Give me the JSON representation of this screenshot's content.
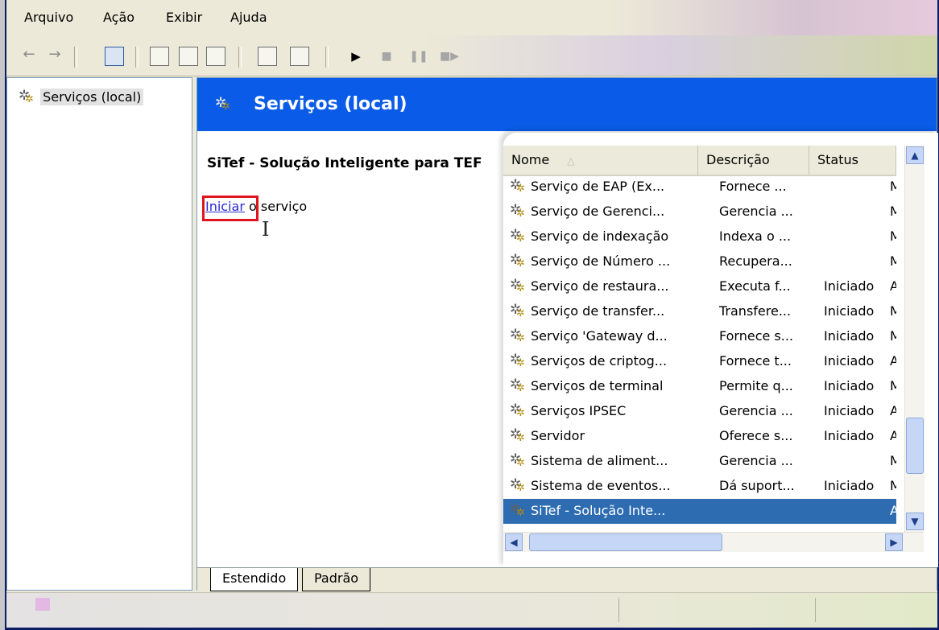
{
  "menu": [
    "Arquivo",
    "Ação",
    "Exibir",
    "Ajuda"
  ],
  "toolbar": {
    "back_icon": "back-arrow-icon",
    "forward_icon": "forward-arrow-icon",
    "play_icon": "play-icon"
  },
  "tree": {
    "root_label": "Serviços (local)"
  },
  "header": {
    "title": "Serviços (local)",
    "color": "#0a5ce8"
  },
  "details": {
    "service_title": "SiTef - Solução Inteligente para TEF",
    "start_link": "Iniciar",
    "start_suffix": " o serviço",
    "highlight_color": "#e0141c"
  },
  "list": {
    "columns": [
      "Nome",
      "Descrição",
      "Status"
    ],
    "rows": [
      {
        "name": "Serviço de EAP (Ex...",
        "desc": "Fornece ...",
        "status": "",
        "cut": "M"
      },
      {
        "name": "Serviço de Gerenci...",
        "desc": "Gerencia ...",
        "status": "",
        "cut": "M"
      },
      {
        "name": "Serviço de indexação",
        "desc": "Indexa o ...",
        "status": "",
        "cut": "M"
      },
      {
        "name": "Serviço de Número ...",
        "desc": "Recupera...",
        "status": "",
        "cut": "M"
      },
      {
        "name": "Serviço de restaura...",
        "desc": "Executa f...",
        "status": "Iniciado",
        "cut": "A"
      },
      {
        "name": "Serviço de transfer...",
        "desc": "Transfere...",
        "status": "Iniciado",
        "cut": "M"
      },
      {
        "name": "Serviço 'Gateway d...",
        "desc": "Fornece s...",
        "status": "Iniciado",
        "cut": "M"
      },
      {
        "name": "Serviços de criptog...",
        "desc": "Fornece t...",
        "status": "Iniciado",
        "cut": "A"
      },
      {
        "name": "Serviços de terminal",
        "desc": "Permite q...",
        "status": "Iniciado",
        "cut": "M"
      },
      {
        "name": "Serviços IPSEC",
        "desc": "Gerencia ...",
        "status": "Iniciado",
        "cut": "A"
      },
      {
        "name": "Servidor",
        "desc": "Oferece s...",
        "status": "Iniciado",
        "cut": "A"
      },
      {
        "name": "Sistema de aliment...",
        "desc": "Gerencia ...",
        "status": "",
        "cut": "M"
      },
      {
        "name": "Sistema de eventos...",
        "desc": "Dá suport...",
        "status": "Iniciado",
        "cut": "M"
      },
      {
        "name": "SiTef - Solução Inte...",
        "desc": "",
        "status": "",
        "cut": "A",
        "selected": true
      }
    ],
    "selected_color": "#2e6cb2"
  },
  "tabs": [
    "Estendido",
    "Padrão"
  ]
}
